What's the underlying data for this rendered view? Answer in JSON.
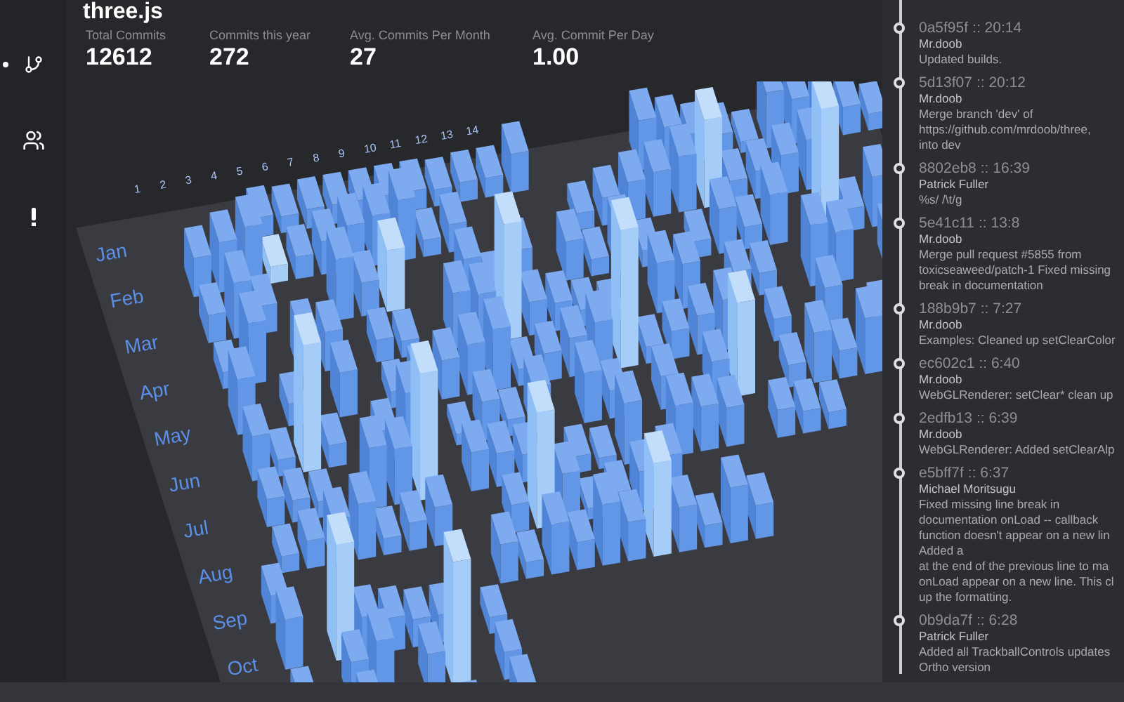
{
  "title": "three.js",
  "sidebar": {
    "items": [
      {
        "kind": "branch",
        "selected": true
      },
      {
        "kind": "people",
        "selected": false
      },
      {
        "kind": "alert",
        "selected": false
      }
    ]
  },
  "stats": [
    {
      "label": "Total Commits",
      "value": "12612"
    },
    {
      "label": "Commits this year",
      "value": "272"
    },
    {
      "label": "Avg. Commits Per Month",
      "value": "27"
    },
    {
      "label": "Avg. Commit Per Day",
      "value": "1.00"
    }
  ],
  "calendar": {
    "months": [
      "Jan",
      "Feb",
      "Mar",
      "Apr",
      "May",
      "Jun",
      "Jul",
      "Aug",
      "Sep",
      "Oct"
    ],
    "days": [
      "1",
      "2",
      "3",
      "4",
      "5",
      "6",
      "7",
      "8",
      "9",
      "10",
      "11",
      "12",
      "13",
      "14"
    ]
  },
  "commits": [
    {
      "hash": "0a5f95f",
      "time": ":: 20:14",
      "author": "Mr.doob",
      "message": [
        "Updated builds."
      ]
    },
    {
      "hash": "5d13f07",
      "time": ":: 20:12",
      "author": "Mr.doob",
      "message": [
        "Merge branch 'dev' of",
        "https://github.com/mrdoob/three,",
        "into dev"
      ]
    },
    {
      "hash": "8802eb8",
      "time": ":: 16:39",
      "author": "Patrick Fuller",
      "message": [
        "%s/ /\\t/g"
      ]
    },
    {
      "hash": "5e41c11",
      "time": ":: 13:8",
      "author": "Mr.doob",
      "message": [
        "Merge pull request #5855 from",
        "toxicseaweed/patch-1 Fixed missing",
        "break in documentation"
      ]
    },
    {
      "hash": "188b9b7",
      "time": ":: 7:27",
      "author": "Mr.doob",
      "message": [
        "Examples: Cleaned up setClearColor"
      ]
    },
    {
      "hash": "ec602c1",
      "time": ":: 6:40",
      "author": "Mr.doob",
      "message": [
        "WebGLRenderer: setClear* clean up"
      ]
    },
    {
      "hash": "2edfb13",
      "time": ":: 6:39",
      "author": "Mr.doob",
      "message": [
        "WebGLRenderer: Added setClearAlp"
      ]
    },
    {
      "hash": "e5bff7f",
      "time": ":: 6:37",
      "author": "Michael Moritsugu",
      "message": [
        "Fixed missing line break in",
        "documentation onLoad -- callback",
        "function doesn't appear on a new lin",
        "Added a",
        "at the end of the previous line to ma",
        "onLoad appear on a new line. This cl",
        "up the formatting."
      ]
    },
    {
      "hash": "0b9da7f",
      "time": ":: 6:28",
      "author": "Patrick Fuller",
      "message": [
        "Added all TrackballControls updates",
        "Ortho version"
      ]
    }
  ]
}
